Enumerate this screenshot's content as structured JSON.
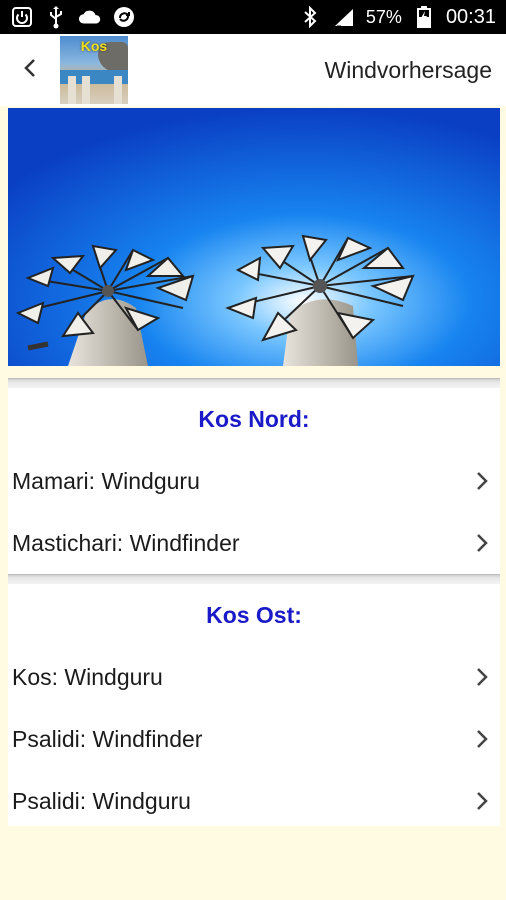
{
  "status_bar": {
    "battery_percent": "57%",
    "time": "00:31",
    "icons": [
      "power-icon",
      "usb-icon",
      "cloud-icon",
      "sync-icon",
      "bluetooth-icon",
      "signal-icon",
      "battery-icon"
    ]
  },
  "app_bar": {
    "back_icon": "chevron-left-icon",
    "logo_text": "Kos",
    "title": "Windvorhersage"
  },
  "hero": {
    "image": "windmills-blue-sky"
  },
  "sections": [
    {
      "header": "Kos Nord:",
      "items": [
        {
          "label": "Mamari: Windguru"
        },
        {
          "label": "Mastichari: Windfinder"
        }
      ]
    },
    {
      "header": "Kos Ost:",
      "items": [
        {
          "label": "Kos: Windguru"
        },
        {
          "label": "Psalidi: Windfinder"
        },
        {
          "label": "Psalidi: Windguru"
        }
      ]
    }
  ],
  "colors": {
    "section_header": "#1a1ac8",
    "page_background": "#fffbe3",
    "sky": "#0b6fe0"
  }
}
